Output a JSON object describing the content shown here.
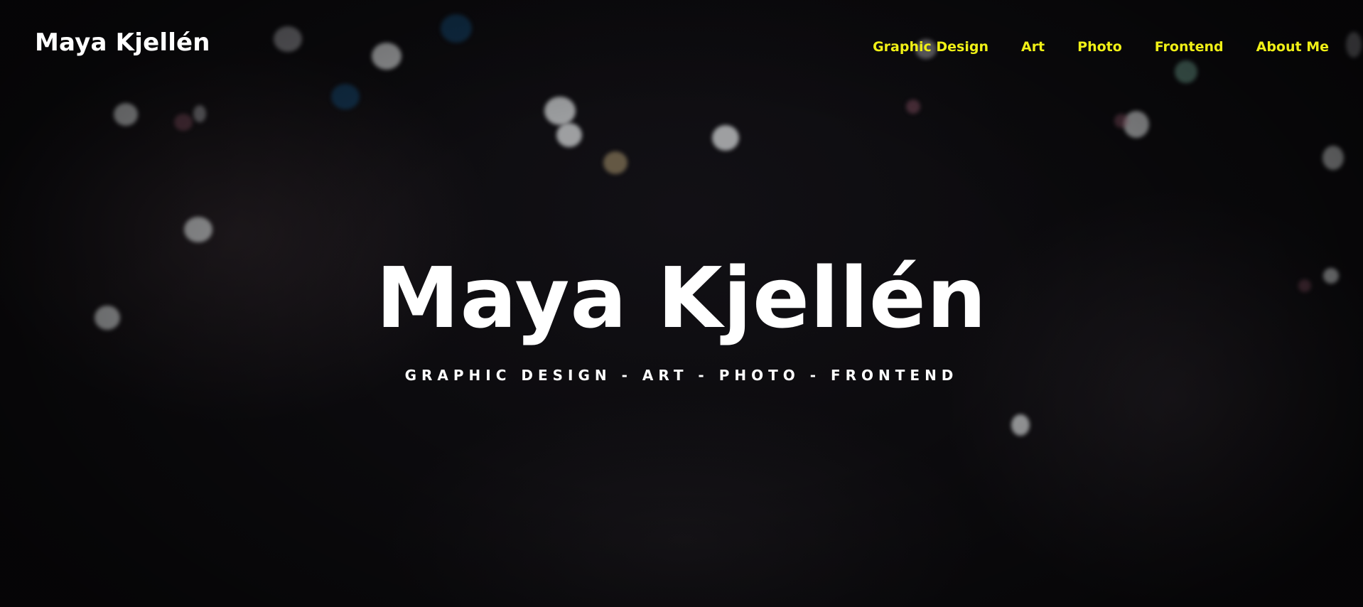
{
  "header": {
    "logo_text": "Maya Kjellén"
  },
  "nav": {
    "items": [
      {
        "label": "Graphic Design"
      },
      {
        "label": "Art"
      },
      {
        "label": "Photo"
      },
      {
        "label": "Frontend"
      },
      {
        "label": "About Me"
      }
    ],
    "link_color": "#f0f016"
  },
  "hero": {
    "title": "Maya Kjellén",
    "tagline": "GRAPHIC DESIGN - ART - PHOTO - FRONTEND"
  },
  "colors": {
    "background": "#0c0b0e",
    "text": "#ffffff",
    "accent": "#f0f016"
  }
}
